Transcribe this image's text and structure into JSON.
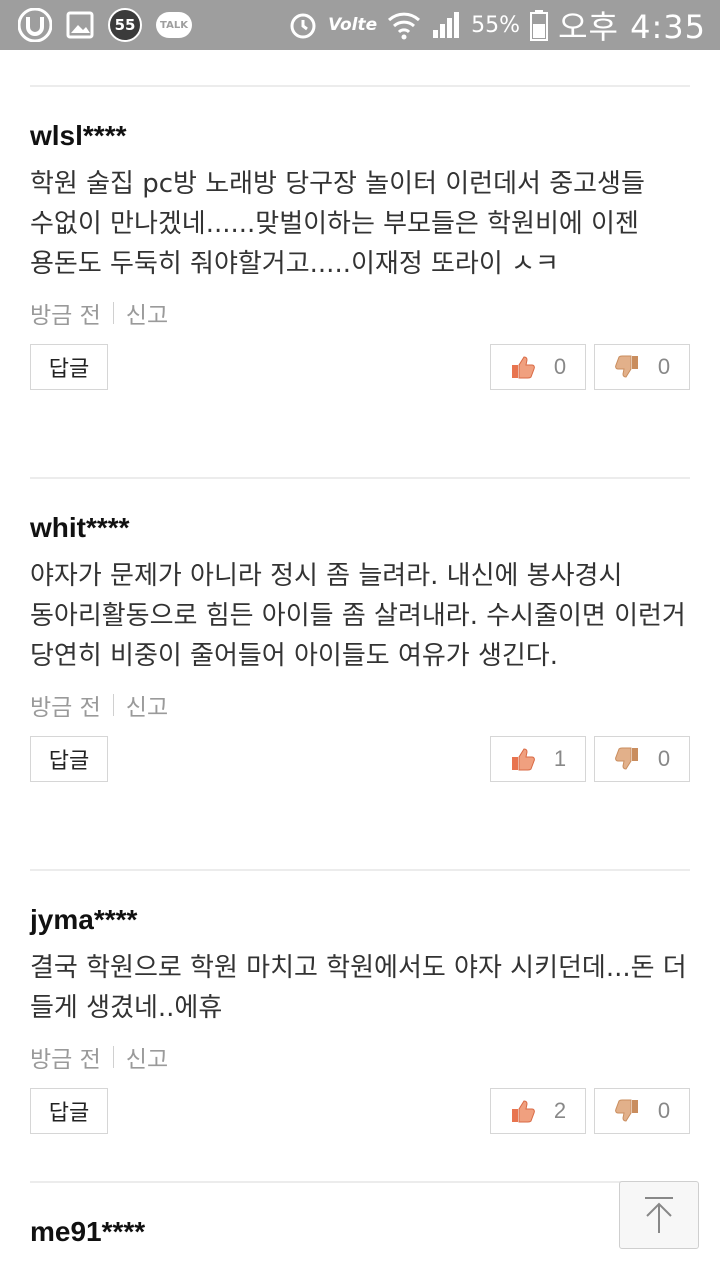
{
  "status_bar": {
    "left_icons": [
      "u-plus-icon",
      "gallery-icon",
      "game-badge-icon",
      "kakaotalk-icon"
    ],
    "badge_number": "55",
    "talk_label": "TALK",
    "volte_label": "Volte",
    "battery_percent": "55%",
    "clock": "오후 4:35"
  },
  "comments": [
    {
      "author": "wlsl****",
      "text": "학원 술집 pc방 노래방 당구장 놀이터 이런데서 중고생들 수없이 만나겠네......맞벌이하는 부모들은 학원비에 이젠 용돈도 두둑히 줘야할거고.....이재정 또라이 ㅅㅋ",
      "time": "방금 전",
      "report": "신고",
      "reply": "답글",
      "likes": "0",
      "dislikes": "0"
    },
    {
      "author": "whit****",
      "text": "야자가 문제가 아니라 정시 좀 늘려라. 내신에 봉사경시 동아리활동으로 힘든 아이들 좀 살려내라. 수시줄이면 이런거 당연히 비중이 줄어들어 아이들도 여유가 생긴다.",
      "time": "방금 전",
      "report": "신고",
      "reply": "답글",
      "likes": "1",
      "dislikes": "0"
    },
    {
      "author": "jyma****",
      "text": "결국 학원으로 학원 마치고 학원에서도 야자 시키던데...돈 더 들게 생겼네..에휴",
      "time": "방금 전",
      "report": "신고",
      "reply": "답글",
      "likes": "2",
      "dislikes": "0"
    },
    {
      "author": "me91****"
    }
  ],
  "colors": {
    "status_bar_bg": "#9e9e9e",
    "thumb_up": "#e8744f",
    "thumb_down": "#d89a6a",
    "divider": "#ececec"
  }
}
